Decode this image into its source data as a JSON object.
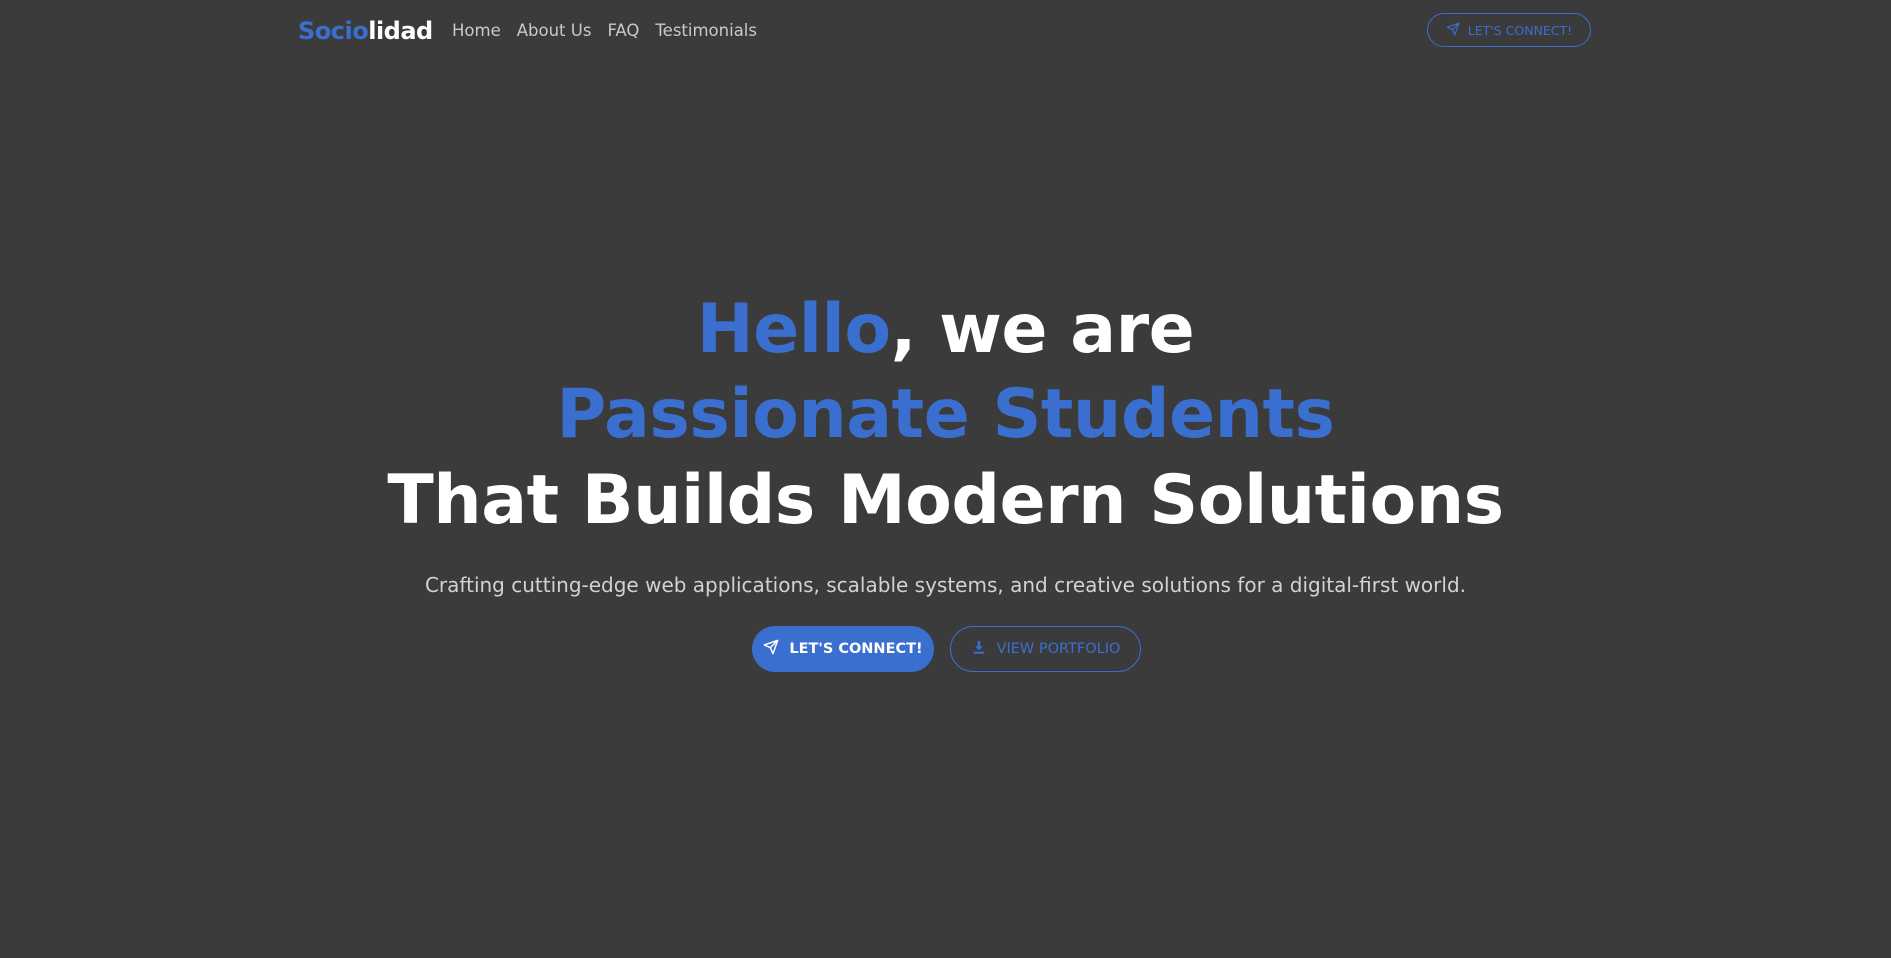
{
  "brand": {
    "part1": "Socio",
    "part2": "lidad",
    "accent_color": "#3a6fd0"
  },
  "nav": {
    "items": [
      {
        "label": "Home"
      },
      {
        "label": "About Us"
      },
      {
        "label": "FAQ"
      },
      {
        "label": "Testimonials"
      }
    ],
    "cta_label": "LET'S CONNECT!",
    "cta_icon": "paper-plane-icon"
  },
  "hero": {
    "line1_blue": "Hello",
    "line1_white": ", we are",
    "line2": "Passionate Students",
    "line3": "That Builds Modern Solutions",
    "subtitle": "Crafting cutting-edge web applications, scalable systems, and creative solutions for a digital-first world.",
    "primary_button": {
      "label": "LET'S CONNECT!",
      "icon": "paper-plane-icon"
    },
    "secondary_button": {
      "label": "VIEW PORTFOLIO",
      "icon": "download-icon"
    }
  },
  "colors": {
    "background": "#3b3b3b",
    "accent": "#3a6fd0",
    "text": "#ffffff",
    "muted_text": "#c9c9c9"
  }
}
